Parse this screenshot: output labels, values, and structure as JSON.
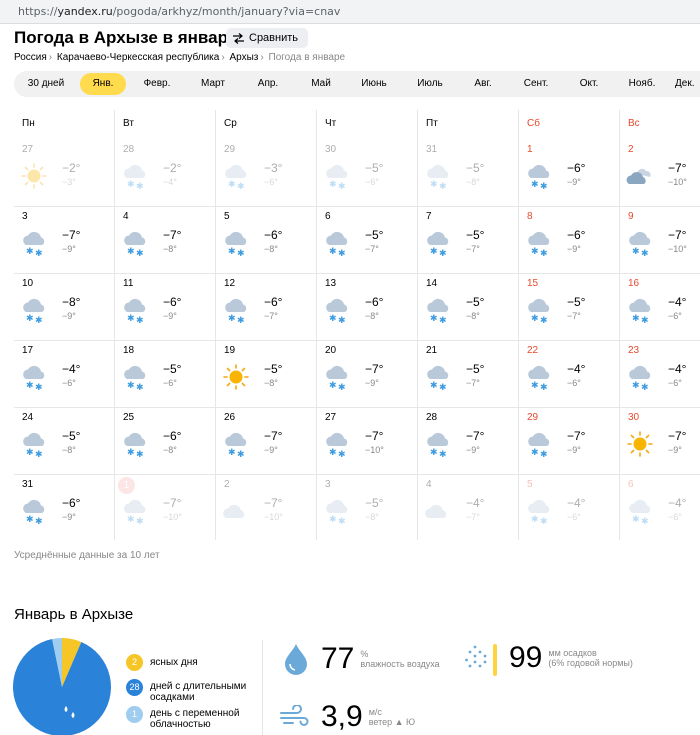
{
  "browser": {
    "url_prefix": "https://",
    "url_host": "yandex.ru",
    "url_path": "/pogoda/arkhyz/month/january?via=cnav"
  },
  "header": {
    "title": "Погода в Архызе в январе",
    "compare_label": "Сравнить"
  },
  "breadcrumbs": [
    "Россия",
    "Карачаево-Черкесская республика",
    "Архыз",
    "Погода в январе"
  ],
  "months": [
    "30 дней",
    "Янв.",
    "Февр.",
    "Март",
    "Апр.",
    "Май",
    "Июнь",
    "Июль",
    "Авг.",
    "Сент.",
    "Окт.",
    "Нояб.",
    "Дек."
  ],
  "active_month": "Янв.",
  "weekdays": [
    "Пн",
    "Вт",
    "Ср",
    "Чт",
    "Пт",
    "Сб",
    "Вс"
  ],
  "calendar": [
    [
      {
        "d": "27",
        "hi": "−2°",
        "lo": "−3°",
        "icon": "sun",
        "f": true
      },
      {
        "d": "28",
        "hi": "−2°",
        "lo": "−4°",
        "icon": "snow",
        "f": true
      },
      {
        "d": "29",
        "hi": "−3°",
        "lo": "−6°",
        "icon": "snow",
        "f": true
      },
      {
        "d": "30",
        "hi": "−5°",
        "lo": "−6°",
        "icon": "snow",
        "f": true
      },
      {
        "d": "31",
        "hi": "−5°",
        "lo": "−8°",
        "icon": "snow",
        "f": true
      },
      {
        "d": "1",
        "hi": "−6°",
        "lo": "−9°",
        "icon": "snow"
      },
      {
        "d": "2",
        "hi": "−7°",
        "lo": "−10°",
        "icon": "cloudy"
      }
    ],
    [
      {
        "d": "3",
        "hi": "−7°",
        "lo": "−9°",
        "icon": "snow"
      },
      {
        "d": "4",
        "hi": "−7°",
        "lo": "−8°",
        "icon": "snow"
      },
      {
        "d": "5",
        "hi": "−6°",
        "lo": "−8°",
        "icon": "snow"
      },
      {
        "d": "6",
        "hi": "−5°",
        "lo": "−7°",
        "icon": "snow"
      },
      {
        "d": "7",
        "hi": "−5°",
        "lo": "−7°",
        "icon": "snow"
      },
      {
        "d": "8",
        "hi": "−6°",
        "lo": "−9°",
        "icon": "snow"
      },
      {
        "d": "9",
        "hi": "−7°",
        "lo": "−10°",
        "icon": "snow"
      }
    ],
    [
      {
        "d": "10",
        "hi": "−8°",
        "lo": "−9°",
        "icon": "snow"
      },
      {
        "d": "11",
        "hi": "−6°",
        "lo": "−9°",
        "icon": "snow"
      },
      {
        "d": "12",
        "hi": "−6°",
        "lo": "−7°",
        "icon": "snow"
      },
      {
        "d": "13",
        "hi": "−6°",
        "lo": "−8°",
        "icon": "snow"
      },
      {
        "d": "14",
        "hi": "−5°",
        "lo": "−8°",
        "icon": "snow"
      },
      {
        "d": "15",
        "hi": "−5°",
        "lo": "−7°",
        "icon": "snow"
      },
      {
        "d": "16",
        "hi": "−4°",
        "lo": "−6°",
        "icon": "snow"
      }
    ],
    [
      {
        "d": "17",
        "hi": "−4°",
        "lo": "−6°",
        "icon": "snow"
      },
      {
        "d": "18",
        "hi": "−5°",
        "lo": "−6°",
        "icon": "snow"
      },
      {
        "d": "19",
        "hi": "−5°",
        "lo": "−8°",
        "icon": "sun"
      },
      {
        "d": "20",
        "hi": "−7°",
        "lo": "−9°",
        "icon": "snow"
      },
      {
        "d": "21",
        "hi": "−5°",
        "lo": "−7°",
        "icon": "snow"
      },
      {
        "d": "22",
        "hi": "−4°",
        "lo": "−6°",
        "icon": "snow"
      },
      {
        "d": "23",
        "hi": "−4°",
        "lo": "−6°",
        "icon": "snow"
      }
    ],
    [
      {
        "d": "24",
        "hi": "−5°",
        "lo": "−8°",
        "icon": "snow"
      },
      {
        "d": "25",
        "hi": "−6°",
        "lo": "−8°",
        "icon": "snow"
      },
      {
        "d": "26",
        "hi": "−7°",
        "lo": "−9°",
        "icon": "snow"
      },
      {
        "d": "27",
        "hi": "−7°",
        "lo": "−10°",
        "icon": "snow"
      },
      {
        "d": "28",
        "hi": "−7°",
        "lo": "−9°",
        "icon": "snow"
      },
      {
        "d": "29",
        "hi": "−7°",
        "lo": "−9°",
        "icon": "snow"
      },
      {
        "d": "30",
        "hi": "−7°",
        "lo": "−9°",
        "icon": "sun"
      }
    ],
    [
      {
        "d": "31",
        "hi": "−6°",
        "lo": "−9°",
        "icon": "snow"
      },
      {
        "d": "1",
        "hi": "−7°",
        "lo": "−10°",
        "icon": "snow",
        "f": true,
        "today": true
      },
      {
        "d": "2",
        "hi": "−7°",
        "lo": "−10°",
        "icon": "cloud",
        "f": true
      },
      {
        "d": "3",
        "hi": "−5°",
        "lo": "−8°",
        "icon": "snow",
        "f": true
      },
      {
        "d": "4",
        "hi": "−4°",
        "lo": "−7°",
        "icon": "cloud",
        "f": true
      },
      {
        "d": "5",
        "hi": "−4°",
        "lo": "−6°",
        "icon": "snow",
        "f": true
      },
      {
        "d": "6",
        "hi": "−4°",
        "lo": "−6°",
        "icon": "snow",
        "f": true
      }
    ]
  ],
  "footnote": "Усреднённые данные за 10 лет",
  "summary": {
    "title": "Январь в Архызе",
    "pie": [
      {
        "label": "ясных дня",
        "value": 2,
        "color": "#f6c627"
      },
      {
        "label": "дней с длительными осадками",
        "value": 28,
        "color": "#2b82d9"
      },
      {
        "label": "день с переменной облачностью",
        "value": 1,
        "color": "#9fcdef"
      }
    ],
    "humidity": {
      "value": "77",
      "unit": "%",
      "label": "влажность воздуха"
    },
    "precip": {
      "value": "99",
      "unit": "мм осадков",
      "label": "(6% годовой нормы)"
    },
    "wind": {
      "value": "3,9",
      "unit": "м/с",
      "label": "ветер ▲ Ю"
    }
  },
  "colors": {
    "accent": "#ffdb4d",
    "weekend": "#e6492d",
    "sun": "#f6a60f",
    "cloud": "#b9c9d9",
    "snow": "#4aa3df",
    "rain_blue": "#6aa9d8"
  }
}
